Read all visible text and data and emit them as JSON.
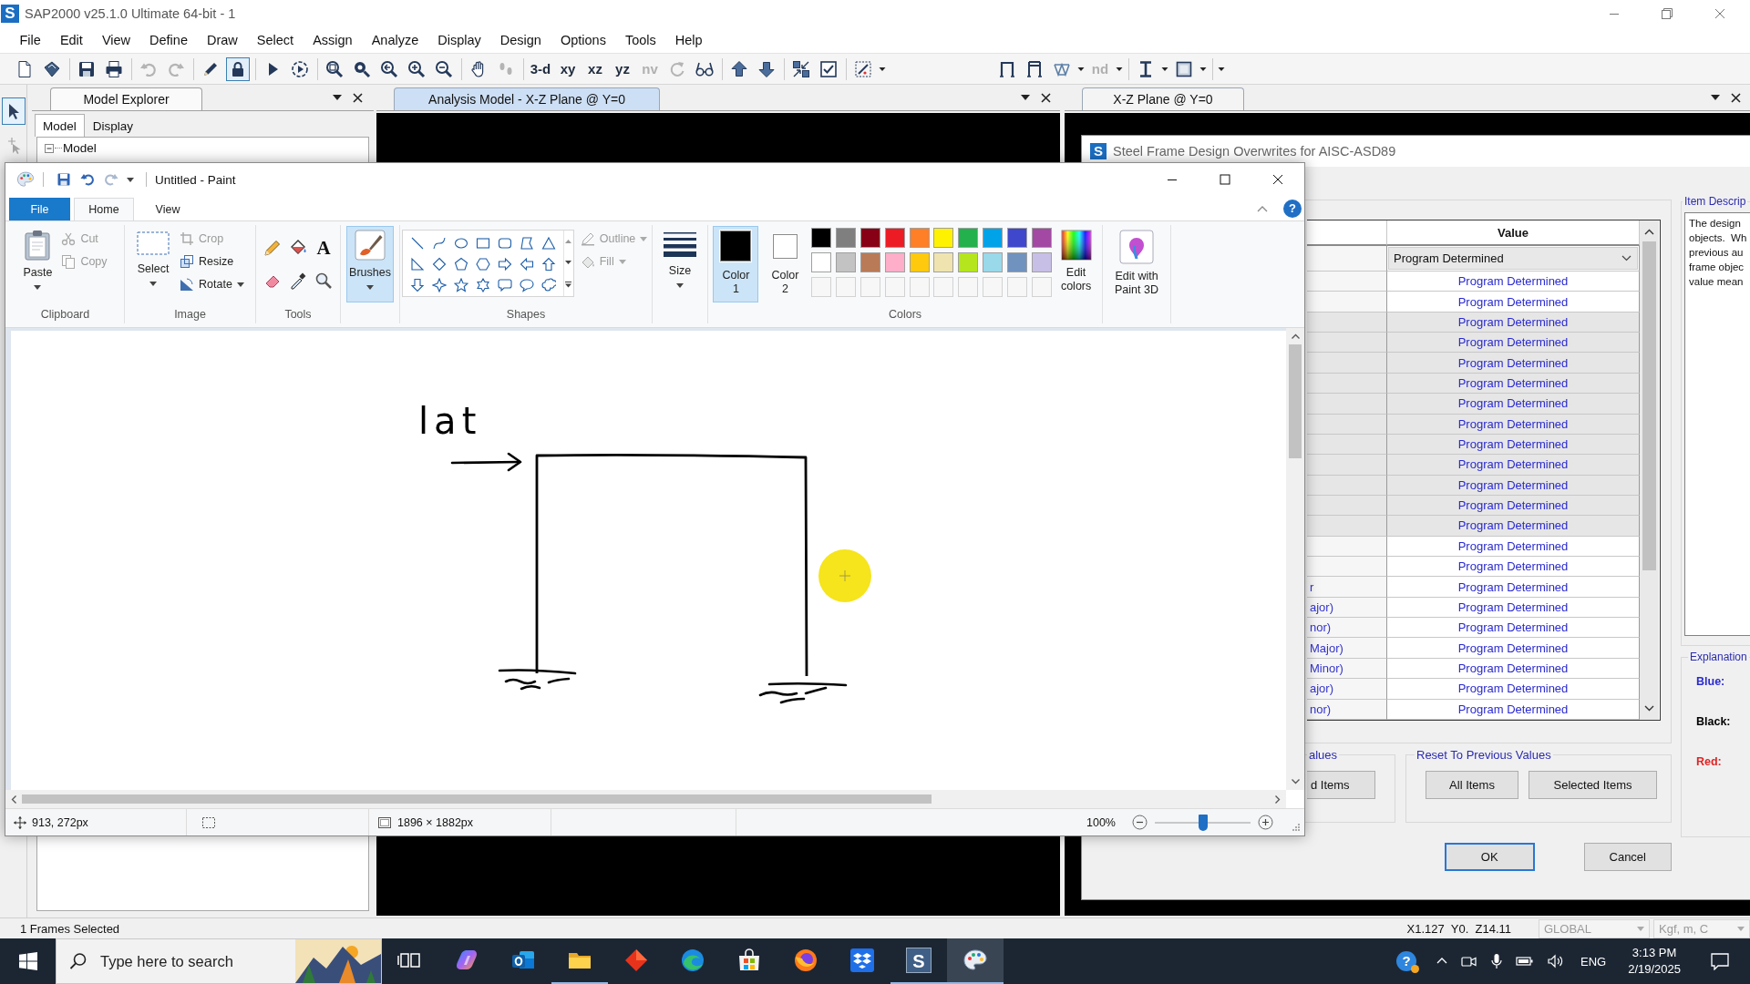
{
  "window": {
    "icon_letter": "S",
    "title": "SAP2000 v25.1.0 Ultimate 64-bit - 1"
  },
  "menu": [
    "File",
    "Edit",
    "View",
    "Define",
    "Draw",
    "Select",
    "Assign",
    "Analyze",
    "Display",
    "Design",
    "Options",
    "Tools",
    "Help"
  ],
  "toolbars": [
    [
      [
        {
          "kind": "new",
          "disabled": false
        },
        {
          "kind": "open",
          "disabled": false
        }
      ],
      [
        {
          "kind": "save",
          "disabled": false
        },
        {
          "kind": "print",
          "disabled": false
        }
      ],
      [
        {
          "kind": "undo",
          "disabled": true
        },
        {
          "kind": "redo",
          "disabled": true
        }
      ],
      [
        {
          "kind": "draw",
          "disabled": false
        },
        {
          "kind": "lock",
          "on": true
        }
      ],
      [
        {
          "kind": "run",
          "disabled": false
        },
        {
          "kind": "run_step",
          "disabled": false
        }
      ],
      [
        {
          "kind": "zoom_window",
          "disabled": false
        },
        {
          "kind": "zoom_full",
          "disabled": false
        },
        {
          "kind": "zoom_previous",
          "disabled": false
        },
        {
          "kind": "zoom_in",
          "disabled": false
        },
        {
          "kind": "zoom_out",
          "disabled": false
        }
      ],
      [
        {
          "kind": "pan",
          "disabled": false
        },
        {
          "kind": "footprints",
          "disabled": true
        }
      ],
      [
        {
          "kind": "text",
          "label": "3-d",
          "disabled": false
        },
        {
          "kind": "text",
          "label": "xy",
          "disabled": false
        },
        {
          "kind": "text",
          "label": "xz",
          "disabled": false
        },
        {
          "kind": "text",
          "label": "yz",
          "disabled": false
        },
        {
          "kind": "text",
          "label": "nv",
          "disabled": true
        },
        {
          "kind": "rotate",
          "disabled": true
        },
        {
          "kind": "glasses",
          "disabled": false
        }
      ],
      [
        {
          "kind": "up",
          "disabled": false
        },
        {
          "kind": "down",
          "disabled": false
        }
      ],
      [
        {
          "kind": "shrink",
          "disabled": false
        },
        {
          "kind": "check",
          "disabled": false
        }
      ],
      [
        {
          "kind": "display",
          "disabled": false
        },
        {
          "kind": "caret"
        }
      ]
    ],
    [
      [
        {
          "kind": "frame",
          "disabled": false
        },
        {
          "kind": "braced",
          "disabled": false
        },
        {
          "kind": "truss",
          "disabled": false
        },
        {
          "kind": "caret"
        },
        {
          "kind": "text",
          "label": "nd",
          "disabled": true
        },
        {
          "kind": "caret"
        }
      ],
      [
        {
          "kind": "ibeam",
          "disabled": false
        },
        {
          "kind": "caret"
        },
        {
          "kind": "section",
          "disabled": false
        },
        {
          "kind": "caret"
        }
      ],
      [
        {
          "kind": "caret"
        }
      ]
    ]
  ],
  "tool_palette": [
    {
      "kind": "pointer",
      "selected": true,
      "disabled": false
    },
    {
      "kind": "reshape",
      "selected": false,
      "disabled": true
    }
  ],
  "model_explorer": {
    "title": "Model Explorer",
    "tabs": [
      {
        "label": "Model",
        "selected": true
      },
      {
        "label": "Display",
        "selected": false
      }
    ],
    "tree": [
      {
        "label": "Model",
        "expanded": true
      }
    ]
  },
  "views": [
    {
      "tab": "Analysis Model - X-Z Plane @ Y=0",
      "selected": true
    },
    {
      "tab": "X-Z Plane @ Y=0",
      "selected": false
    }
  ],
  "dialog": {
    "icon_letter": "S",
    "title": "Steel Frame Design Overwrites for AISC-ASD89",
    "table": {
      "columns": [
        "Value"
      ],
      "rows": [
        {
          "kind": "dropdown",
          "value": "Program Determined",
          "shaded": false
        },
        {
          "kind": "text",
          "value": "Program Determined",
          "shaded": false
        },
        {
          "kind": "text",
          "value": "Program Determined",
          "shaded": false
        },
        {
          "kind": "text",
          "value": "Program Determined",
          "shaded": true
        },
        {
          "kind": "text",
          "value": "Program Determined",
          "shaded": true
        },
        {
          "kind": "text",
          "value": "Program Determined",
          "shaded": true
        },
        {
          "kind": "text",
          "value": "Program Determined",
          "shaded": true
        },
        {
          "kind": "text",
          "value": "Program Determined",
          "shaded": true
        },
        {
          "kind": "text",
          "value": "Program Determined",
          "shaded": true
        },
        {
          "kind": "text",
          "value": "Program Determined",
          "shaded": true
        },
        {
          "kind": "text",
          "value": "Program Determined",
          "shaded": true
        },
        {
          "kind": "text",
          "value": "Program Determined",
          "shaded": true
        },
        {
          "kind": "text",
          "value": "Program Determined",
          "shaded": true
        },
        {
          "kind": "text",
          "value": "Program Determined",
          "shaded": true
        },
        {
          "kind": "text",
          "value": "Program Determined",
          "shaded": false
        },
        {
          "kind": "text",
          "value": "Program Determined",
          "shaded": false
        },
        {
          "kind": "text",
          "item": "r",
          "value": "Program Determined",
          "shaded": false
        },
        {
          "kind": "text",
          "item": "ajor)",
          "value": "Program Determined",
          "shaded": false
        },
        {
          "kind": "text",
          "item": "nor)",
          "value": "Program Determined",
          "shaded": false
        },
        {
          "kind": "text",
          "item": "Major)",
          "value": "Program Determined",
          "shaded": false
        },
        {
          "kind": "text",
          "item": "Minor)",
          "value": "Program Determined",
          "shaded": false
        },
        {
          "kind": "text",
          "item": "ajor)",
          "value": "Program Determined",
          "shaded": false
        },
        {
          "kind": "text",
          "item": "nor)",
          "value": "Program Determined",
          "shaded": false
        }
      ]
    },
    "groups": [
      {
        "label": "alues",
        "buttons": [
          "d Items"
        ]
      },
      {
        "label": "Reset To Previous Values",
        "buttons": [
          "All Items",
          "Selected Items"
        ]
      }
    ],
    "buttons": [
      {
        "label": "OK",
        "default": true
      },
      {
        "label": "Cancel",
        "default": false
      }
    ],
    "description": {
      "label": "Item Descrip",
      "lines": [
        "The design",
        "objects.  Wh",
        "previous au",
        "frame objec",
        "value mean"
      ]
    },
    "explanation": {
      "label": "Explanation",
      "legend": [
        {
          "label": "Blue:",
          "color": "#2a2ad0"
        },
        {
          "label": "Black:",
          "color": "#000000"
        },
        {
          "label": "Red:",
          "color": "#e02424"
        }
      ]
    }
  },
  "paint": {
    "title": "Untitled - Paint",
    "quick_access": [
      {
        "kind": "save",
        "disabled": false
      },
      {
        "kind": "undo",
        "disabled": false
      },
      {
        "kind": "redo",
        "disabled": true
      }
    ],
    "file_tab": "File",
    "tabs": [
      {
        "label": "Home",
        "selected": true
      },
      {
        "label": "View",
        "selected": false
      }
    ],
    "help": "?",
    "clipboard": {
      "label": "Clipboard",
      "paste": "Paste",
      "actions": [
        {
          "kind": "cut",
          "label": "Cut",
          "disabled": true
        },
        {
          "kind": "copy",
          "label": "Copy",
          "disabled": true
        }
      ]
    },
    "image": {
      "label": "Image",
      "select": "Select",
      "actions": [
        {
          "kind": "crop",
          "label": "Crop",
          "disabled": true
        },
        {
          "kind": "resize",
          "label": "Resize",
          "disabled": false
        },
        {
          "kind": "rotate",
          "label": "Rotate",
          "disabled": false
        }
      ]
    },
    "tools": {
      "label": "Tools",
      "text_tool": "A"
    },
    "brushes": {
      "label": "Brushes",
      "selected": true
    },
    "shapes": {
      "label": "Shapes",
      "options": [
        {
          "kind": "outline",
          "label": "Outline",
          "disabled": true
        },
        {
          "kind": "fill",
          "label": "Fill",
          "disabled": true
        }
      ]
    },
    "size": {
      "label": "Size"
    },
    "colors": {
      "label": "Colors",
      "active": [
        {
          "label": "Color",
          "number": "1",
          "color": "#000000",
          "selected": true
        },
        {
          "label": "Color",
          "number": "2",
          "color": "#ffffff",
          "selected": false
        }
      ],
      "palette": [
        {
          "color": "#000000"
        },
        {
          "color": "#7f7f7f"
        },
        {
          "color": "#880015"
        },
        {
          "color": "#ed1c24"
        },
        {
          "color": "#ff7f27"
        },
        {
          "color": "#fff200"
        },
        {
          "color": "#22b14c"
        },
        {
          "color": "#00a2e8"
        },
        {
          "color": "#3f48cc"
        },
        {
          "color": "#a349a4"
        },
        {
          "color": "#ffffff"
        },
        {
          "color": "#c3c3c3"
        },
        {
          "color": "#b97a57"
        },
        {
          "color": "#ffaec9"
        },
        {
          "color": "#ffc90e"
        },
        {
          "color": "#efe4b0"
        },
        {
          "color": "#b5e61d"
        },
        {
          "color": "#99d9ea"
        },
        {
          "color": "#7092be"
        },
        {
          "color": "#c8bfe7"
        }
      ],
      "edit": "Edit colors"
    },
    "paint3d": "Edit with Paint 3D",
    "canvas": {
      "text": "lat"
    },
    "status": {
      "position": "913, 272px",
      "size": "1896 × 1882px",
      "zoom": "100%",
      "level": 0.5
    }
  },
  "status_bar": {
    "selection": "1 Frames Selected",
    "coordinates": "X1.127  Y0.  Z14.11",
    "coord_system": {
      "value": "GLOBAL",
      "disabled": true
    },
    "units": {
      "value": "Kgf, m, C",
      "disabled": true
    }
  },
  "taskbar": {
    "search": {
      "placeholder": "Type here to search"
    },
    "apps": [
      {
        "kind": "taskview",
        "running": false,
        "selected": false
      },
      {
        "kind": "sparkle",
        "running": false,
        "selected": false
      },
      {
        "kind": "mail",
        "running": false,
        "selected": false
      },
      {
        "kind": "folder",
        "running": true,
        "selected": false
      },
      {
        "kind": "diamond",
        "running": false,
        "selected": false
      },
      {
        "kind": "swirl",
        "running": false,
        "selected": false
      },
      {
        "kind": "bag",
        "running": false,
        "selected": false
      },
      {
        "kind": "fox",
        "running": false,
        "selected": false
      },
      {
        "kind": "box",
        "running": false,
        "selected": false
      },
      {
        "kind": "letter",
        "letter": "S",
        "running": true,
        "selected": false
      },
      {
        "kind": "palette",
        "running": true,
        "selected": true
      }
    ],
    "help": "?",
    "language": "ENG",
    "time": "3:13 PM",
    "date": "2/19/2025"
  }
}
